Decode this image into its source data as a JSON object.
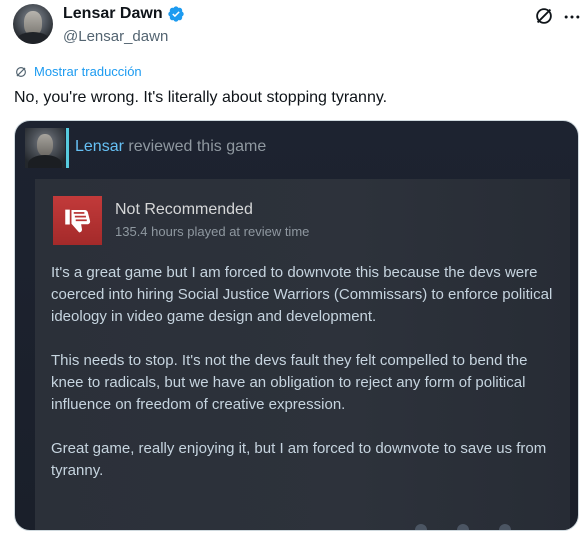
{
  "author": {
    "display_name": "Lensar Dawn",
    "handle": "@Lensar_dawn",
    "verified_icon": "verified-badge-icon"
  },
  "actions": {
    "translate_label": "Mostrar traducción"
  },
  "tweet": {
    "text": "No, you're wrong. It's literally about stopping tyranny."
  },
  "review": {
    "reviewer": "Lensar",
    "header_rest": "reviewed this game",
    "verdict": "Not Recommended",
    "hours": "135.4 hours played at review time",
    "paragraphs": [
      "It's a great game but I am forced to downvote this because the devs were coerced into hiring Social Justice Warriors (Commissars) to enforce political ideology in video game design and development.",
      "This needs to stop. It's not the devs fault they felt compelled to bend the knee to radicals, but we have an obligation to reject any form of political influence on freedom of creative expression.",
      "Great game, really enjoying it, but I am forced to downvote to save us from tyranny."
    ]
  },
  "colors": {
    "link_blue": "#1d9bf0",
    "steam_user": "#66c0f4",
    "thumb_red": "#c23a3a"
  }
}
